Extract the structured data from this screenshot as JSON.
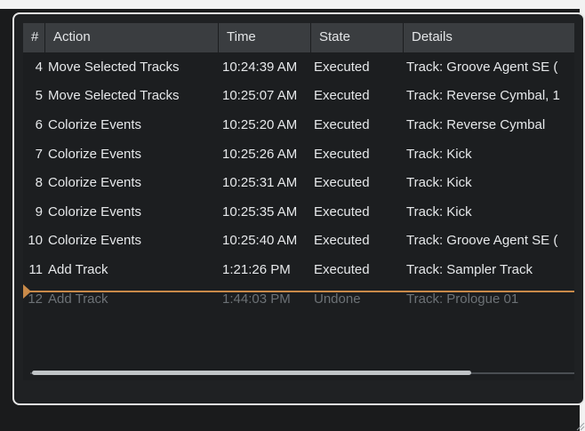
{
  "columns": {
    "num": "#",
    "action": "Action",
    "time": "Time",
    "state": "State",
    "details": "Details"
  },
  "rows": [
    {
      "num": "4",
      "action": "Move Selected Tracks",
      "time": "10:24:39 AM",
      "state": "Executed",
      "details": "Track: Groove Agent SE ("
    },
    {
      "num": "5",
      "action": "Move Selected Tracks",
      "time": "10:25:07 AM",
      "state": "Executed",
      "details": "Track: Reverse Cymbal, 1"
    },
    {
      "num": "6",
      "action": "Colorize Events",
      "time": "10:25:20 AM",
      "state": "Executed",
      "details": "Track: Reverse Cymbal"
    },
    {
      "num": "7",
      "action": "Colorize Events",
      "time": "10:25:26 AM",
      "state": "Executed",
      "details": "Track: Kick"
    },
    {
      "num": "8",
      "action": "Colorize Events",
      "time": "10:25:31 AM",
      "state": "Executed",
      "details": "Track: Kick"
    },
    {
      "num": "9",
      "action": "Colorize Events",
      "time": "10:25:35 AM",
      "state": "Executed",
      "details": "Track: Kick"
    },
    {
      "num": "10",
      "action": "Colorize Events",
      "time": "10:25:40 AM",
      "state": "Executed",
      "details": "Track: Groove Agent SE ("
    },
    {
      "num": "11",
      "action": "Add Track",
      "time": "1:21:26 PM",
      "state": "Executed",
      "details": "Track: Sampler Track"
    },
    {
      "num": "12",
      "action": "Add Track",
      "time": "1:44:03 PM",
      "state": "Undone",
      "details": "Track: Prologue 01"
    }
  ],
  "colors": {
    "undo_marker": "#c98a49",
    "undone_text": "#6c7175",
    "header_bg": "#3a3d40"
  }
}
